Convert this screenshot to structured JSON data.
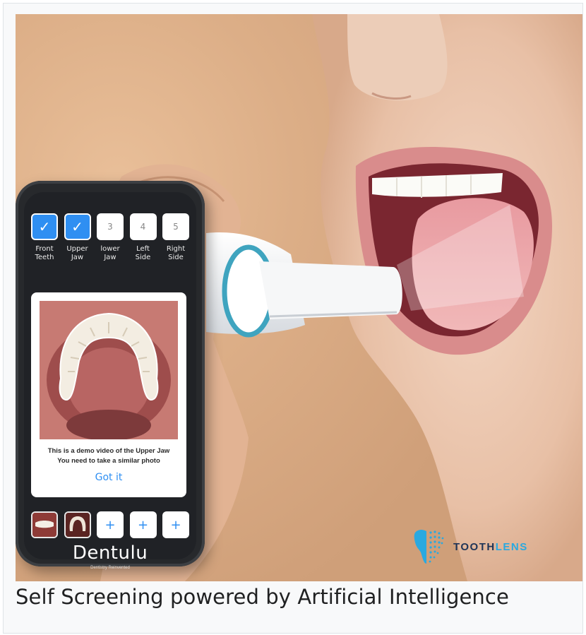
{
  "phone": {
    "steps": [
      {
        "number": "",
        "label": "Front\nTeeth",
        "done": true
      },
      {
        "number": "",
        "label": "Upper\nJaw",
        "done": true
      },
      {
        "number": "3",
        "label": "lower\nJaw",
        "done": false
      },
      {
        "number": "4",
        "label": "Left\nSide",
        "done": false
      },
      {
        "number": "5",
        "label": "Right\nSide",
        "done": false
      }
    ],
    "card": {
      "line1": "This is a demo video of the Upper Jaw",
      "line2": "You need to take a similar photo",
      "button": "Got it"
    },
    "thumbs": [
      "photo",
      "photo",
      "+",
      "+",
      "+"
    ],
    "brand": "Dentulu",
    "brand_sub": "Dentistry Reinvented"
  },
  "logo": {
    "part1": "TOOTH",
    "part2": "LENS",
    "color_dark": "#1f3457",
    "color_accent": "#2aa9e0"
  },
  "caption": "Self Screening powered by Artificial Intelligence",
  "colors": {
    "accent": "#2f8ff2",
    "background": "#d9ab84"
  }
}
